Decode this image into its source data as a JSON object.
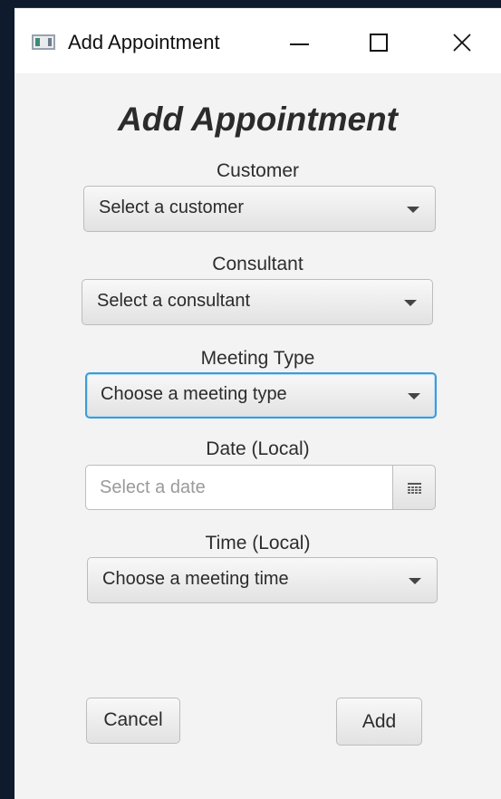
{
  "window": {
    "title": "Add Appointment",
    "controls": [
      "minimize-icon",
      "maximize-icon",
      "close-icon"
    ]
  },
  "form": {
    "heading": "Add Appointment",
    "customer": {
      "label": "Customer",
      "value": "Select a customer"
    },
    "consultant": {
      "label": "Consultant",
      "value": "Select a consultant"
    },
    "meeting_type": {
      "label": "Meeting Type",
      "value": "Choose a meeting type"
    },
    "date": {
      "label": "Date (Local)",
      "placeholder": "Select a date",
      "value": ""
    },
    "time": {
      "label": "Time (Local)",
      "value": "Choose a meeting time"
    }
  },
  "actions": {
    "cancel_label": "Cancel",
    "add_label": "Add"
  },
  "colors": {
    "focus_border": "#3d9bd8",
    "window_bg": "#f3f3f3",
    "titlebar_bg": "#ffffff"
  }
}
